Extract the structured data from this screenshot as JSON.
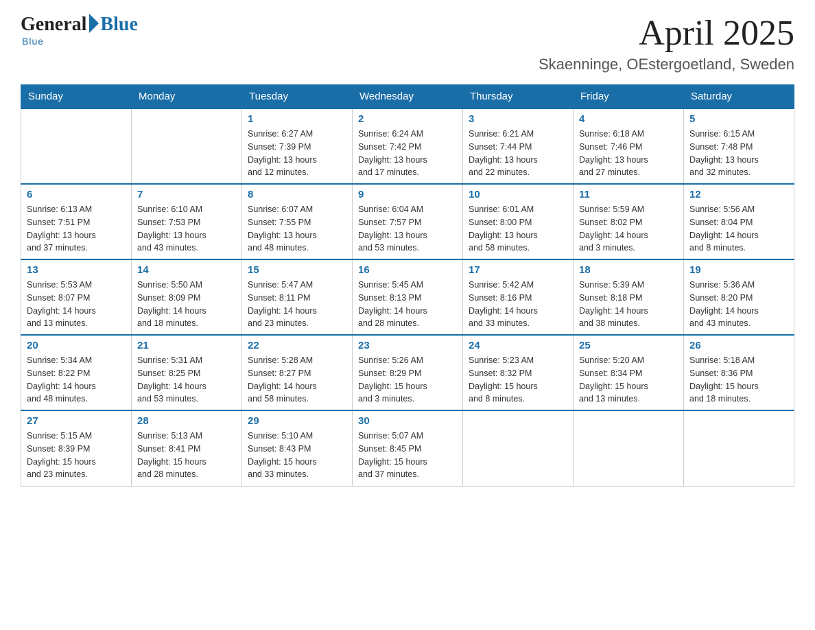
{
  "header": {
    "logo_general": "General",
    "logo_blue": "Blue",
    "logo_sub": "Blue",
    "month_title": "April 2025",
    "location": "Skaenninge, OEstergoetland, Sweden"
  },
  "weekdays": [
    "Sunday",
    "Monday",
    "Tuesday",
    "Wednesday",
    "Thursday",
    "Friday",
    "Saturday"
  ],
  "weeks": [
    [
      {
        "day": "",
        "info": ""
      },
      {
        "day": "",
        "info": ""
      },
      {
        "day": "1",
        "info": "Sunrise: 6:27 AM\nSunset: 7:39 PM\nDaylight: 13 hours\nand 12 minutes."
      },
      {
        "day": "2",
        "info": "Sunrise: 6:24 AM\nSunset: 7:42 PM\nDaylight: 13 hours\nand 17 minutes."
      },
      {
        "day": "3",
        "info": "Sunrise: 6:21 AM\nSunset: 7:44 PM\nDaylight: 13 hours\nand 22 minutes."
      },
      {
        "day": "4",
        "info": "Sunrise: 6:18 AM\nSunset: 7:46 PM\nDaylight: 13 hours\nand 27 minutes."
      },
      {
        "day": "5",
        "info": "Sunrise: 6:15 AM\nSunset: 7:48 PM\nDaylight: 13 hours\nand 32 minutes."
      }
    ],
    [
      {
        "day": "6",
        "info": "Sunrise: 6:13 AM\nSunset: 7:51 PM\nDaylight: 13 hours\nand 37 minutes."
      },
      {
        "day": "7",
        "info": "Sunrise: 6:10 AM\nSunset: 7:53 PM\nDaylight: 13 hours\nand 43 minutes."
      },
      {
        "day": "8",
        "info": "Sunrise: 6:07 AM\nSunset: 7:55 PM\nDaylight: 13 hours\nand 48 minutes."
      },
      {
        "day": "9",
        "info": "Sunrise: 6:04 AM\nSunset: 7:57 PM\nDaylight: 13 hours\nand 53 minutes."
      },
      {
        "day": "10",
        "info": "Sunrise: 6:01 AM\nSunset: 8:00 PM\nDaylight: 13 hours\nand 58 minutes."
      },
      {
        "day": "11",
        "info": "Sunrise: 5:59 AM\nSunset: 8:02 PM\nDaylight: 14 hours\nand 3 minutes."
      },
      {
        "day": "12",
        "info": "Sunrise: 5:56 AM\nSunset: 8:04 PM\nDaylight: 14 hours\nand 8 minutes."
      }
    ],
    [
      {
        "day": "13",
        "info": "Sunrise: 5:53 AM\nSunset: 8:07 PM\nDaylight: 14 hours\nand 13 minutes."
      },
      {
        "day": "14",
        "info": "Sunrise: 5:50 AM\nSunset: 8:09 PM\nDaylight: 14 hours\nand 18 minutes."
      },
      {
        "day": "15",
        "info": "Sunrise: 5:47 AM\nSunset: 8:11 PM\nDaylight: 14 hours\nand 23 minutes."
      },
      {
        "day": "16",
        "info": "Sunrise: 5:45 AM\nSunset: 8:13 PM\nDaylight: 14 hours\nand 28 minutes."
      },
      {
        "day": "17",
        "info": "Sunrise: 5:42 AM\nSunset: 8:16 PM\nDaylight: 14 hours\nand 33 minutes."
      },
      {
        "day": "18",
        "info": "Sunrise: 5:39 AM\nSunset: 8:18 PM\nDaylight: 14 hours\nand 38 minutes."
      },
      {
        "day": "19",
        "info": "Sunrise: 5:36 AM\nSunset: 8:20 PM\nDaylight: 14 hours\nand 43 minutes."
      }
    ],
    [
      {
        "day": "20",
        "info": "Sunrise: 5:34 AM\nSunset: 8:22 PM\nDaylight: 14 hours\nand 48 minutes."
      },
      {
        "day": "21",
        "info": "Sunrise: 5:31 AM\nSunset: 8:25 PM\nDaylight: 14 hours\nand 53 minutes."
      },
      {
        "day": "22",
        "info": "Sunrise: 5:28 AM\nSunset: 8:27 PM\nDaylight: 14 hours\nand 58 minutes."
      },
      {
        "day": "23",
        "info": "Sunrise: 5:26 AM\nSunset: 8:29 PM\nDaylight: 15 hours\nand 3 minutes."
      },
      {
        "day": "24",
        "info": "Sunrise: 5:23 AM\nSunset: 8:32 PM\nDaylight: 15 hours\nand 8 minutes."
      },
      {
        "day": "25",
        "info": "Sunrise: 5:20 AM\nSunset: 8:34 PM\nDaylight: 15 hours\nand 13 minutes."
      },
      {
        "day": "26",
        "info": "Sunrise: 5:18 AM\nSunset: 8:36 PM\nDaylight: 15 hours\nand 18 minutes."
      }
    ],
    [
      {
        "day": "27",
        "info": "Sunrise: 5:15 AM\nSunset: 8:39 PM\nDaylight: 15 hours\nand 23 minutes."
      },
      {
        "day": "28",
        "info": "Sunrise: 5:13 AM\nSunset: 8:41 PM\nDaylight: 15 hours\nand 28 minutes."
      },
      {
        "day": "29",
        "info": "Sunrise: 5:10 AM\nSunset: 8:43 PM\nDaylight: 15 hours\nand 33 minutes."
      },
      {
        "day": "30",
        "info": "Sunrise: 5:07 AM\nSunset: 8:45 PM\nDaylight: 15 hours\nand 37 minutes."
      },
      {
        "day": "",
        "info": ""
      },
      {
        "day": "",
        "info": ""
      },
      {
        "day": "",
        "info": ""
      }
    ]
  ]
}
